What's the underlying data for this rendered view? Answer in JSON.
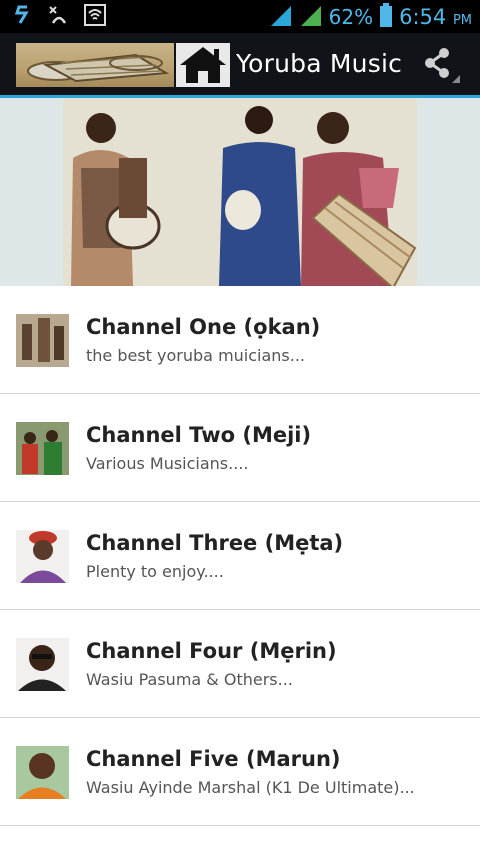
{
  "status_bar": {
    "battery_percent": "62%",
    "time": "6:54",
    "time_suffix": "PM",
    "icons": [
      "usb-debug-icon",
      "signal-cross-icon",
      "wifi-box-icon",
      "signal-bars-icon",
      "signal-bars-icon",
      "battery-icon"
    ],
    "accent": "#4fb8e8"
  },
  "action_bar": {
    "title": "Yoruba Music",
    "home_icon": "home-icon",
    "share_icon": "share-icon",
    "underline_color": "#2aa7d8"
  },
  "channels": [
    {
      "title": "Channel One (ọkan)",
      "subtitle": "the best yoruba muicians..."
    },
    {
      "title": "Channel Two (Meji)",
      "subtitle": "Various Musicians...."
    },
    {
      "title": "Channel Three (Mẹta)",
      "subtitle": "Plenty to enjoy...."
    },
    {
      "title": "Channel Four (Mẹrin)",
      "subtitle": "Wasiu Pasuma & Others..."
    },
    {
      "title": "Channel Five (Marun)",
      "subtitle": "Wasiu Ayinde Marshal (K1 De Ultimate)..."
    }
  ]
}
